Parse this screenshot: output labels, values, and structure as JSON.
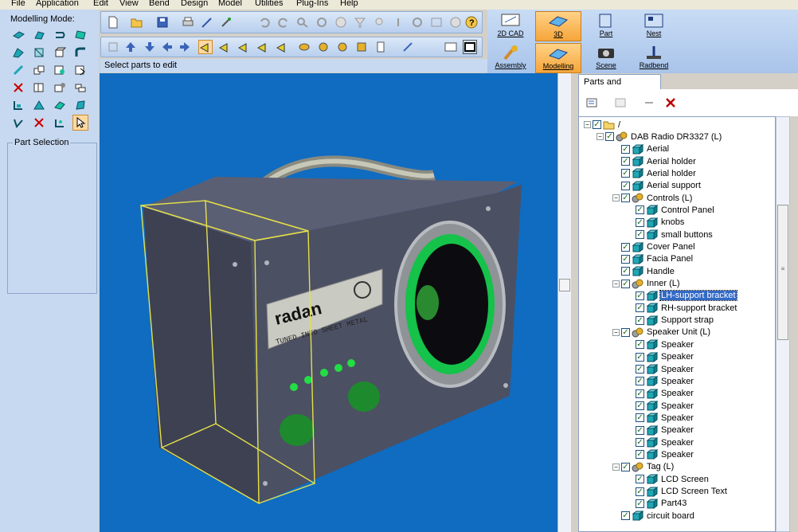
{
  "menu": [
    "File",
    "Application",
    "Edit",
    "View",
    "Bend",
    "Design",
    "Model",
    "Utilities",
    "Plug-Ins",
    "Help"
  ],
  "mode_panel": {
    "title": "Modelling Mode:",
    "part_selection_label": "Part Selection"
  },
  "status_text": "Select parts to edit",
  "mode_buttons": {
    "cad2d": "2D CAD",
    "d3": "3D",
    "part": "Part",
    "nest": "Nest",
    "assembly": "Assembly",
    "modelling": "Modelling",
    "scene": "Scene",
    "radbend": "Radbend"
  },
  "parts_tab": "Parts and Assemblies",
  "radio_label": {
    "brand": "radan",
    "tagline": "TUNED INTO SHEET METAL"
  },
  "tree": [
    {
      "label": "/",
      "level": 0,
      "type": "folder",
      "expand": "-"
    },
    {
      "label": "DAB Radio DR3327 (L)",
      "level": 1,
      "type": "assembly",
      "expand": "-"
    },
    {
      "label": "Aerial",
      "level": 2,
      "type": "part"
    },
    {
      "label": "Aerial holder",
      "level": 2,
      "type": "part"
    },
    {
      "label": "Aerial holder",
      "level": 2,
      "type": "part"
    },
    {
      "label": "Aerial support",
      "level": 2,
      "type": "part"
    },
    {
      "label": "Controls (L)",
      "level": 2,
      "type": "assembly",
      "expand": "-"
    },
    {
      "label": "Control Panel",
      "level": 3,
      "type": "part"
    },
    {
      "label": "knobs",
      "level": 3,
      "type": "part"
    },
    {
      "label": "small buttons",
      "level": 3,
      "type": "part"
    },
    {
      "label": "Cover Panel",
      "level": 2,
      "type": "part"
    },
    {
      "label": "Facia Panel",
      "level": 2,
      "type": "part"
    },
    {
      "label": "Handle",
      "level": 2,
      "type": "part"
    },
    {
      "label": "Inner (L)",
      "level": 2,
      "type": "assembly",
      "expand": "-"
    },
    {
      "label": "LH-support bracket",
      "level": 3,
      "type": "part",
      "selected": true
    },
    {
      "label": "RH-support bracket",
      "level": 3,
      "type": "part"
    },
    {
      "label": "Support strap",
      "level": 3,
      "type": "part"
    },
    {
      "label": "Speaker Unit (L)",
      "level": 2,
      "type": "assembly",
      "expand": "-"
    },
    {
      "label": "Speaker",
      "level": 3,
      "type": "part"
    },
    {
      "label": "Speaker",
      "level": 3,
      "type": "part"
    },
    {
      "label": "Speaker",
      "level": 3,
      "type": "part"
    },
    {
      "label": "Speaker",
      "level": 3,
      "type": "part"
    },
    {
      "label": "Speaker",
      "level": 3,
      "type": "part"
    },
    {
      "label": "Speaker",
      "level": 3,
      "type": "part"
    },
    {
      "label": "Speaker",
      "level": 3,
      "type": "part"
    },
    {
      "label": "Speaker",
      "level": 3,
      "type": "part"
    },
    {
      "label": "Speaker",
      "level": 3,
      "type": "part"
    },
    {
      "label": "Speaker",
      "level": 3,
      "type": "part"
    },
    {
      "label": "Tag (L)",
      "level": 2,
      "type": "assembly",
      "expand": "-"
    },
    {
      "label": "LCD Screen",
      "level": 3,
      "type": "part"
    },
    {
      "label": "LCD Screen Text",
      "level": 3,
      "type": "part"
    },
    {
      "label": "Part43",
      "level": 3,
      "type": "part"
    },
    {
      "label": "circuit board",
      "level": 2,
      "type": "part"
    }
  ],
  "colors": {
    "viewport_bg": "#0f6cc0",
    "panel_bg": "#c7d9f1",
    "active_mode": "#f6a53a",
    "selection": "#3169c6"
  }
}
